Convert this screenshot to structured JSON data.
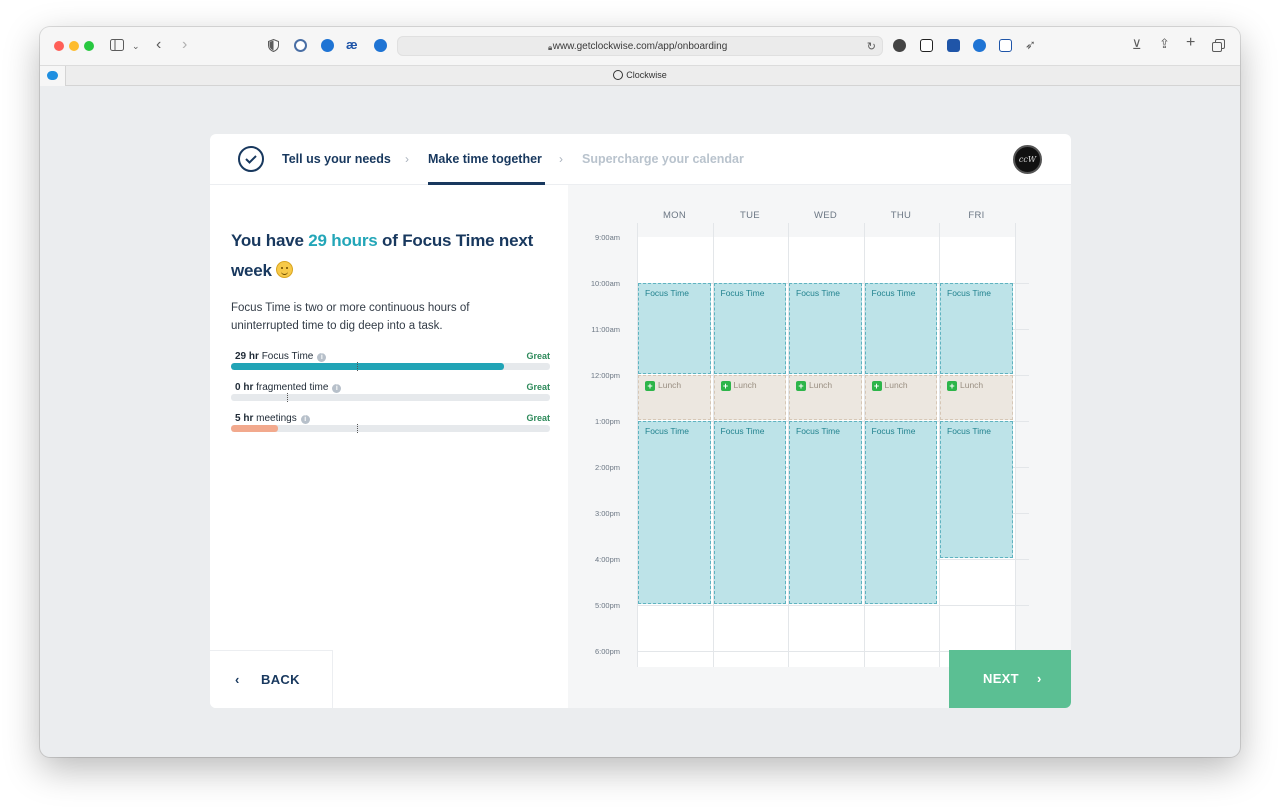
{
  "browser": {
    "url": "www.getclockwise.com/app/onboarding",
    "tab_title": "Clockwise"
  },
  "steps": [
    {
      "label": "Tell us your needs",
      "state": "done"
    },
    {
      "label": "Make time together",
      "state": "active"
    },
    {
      "label": "Supercharge your calendar",
      "state": "upcoming"
    }
  ],
  "avatar_text": "ccW",
  "headline": {
    "prefix": "You have ",
    "accent": "29 hours",
    "suffix": " of Focus Time next week"
  },
  "description": "Focus Time is two or more continuous hours of uninterrupted time to dig deep into a task.",
  "metrics": [
    {
      "value": "29 hr",
      "label": "Focus Time",
      "status": "Great",
      "fill": 0.855,
      "marker": 0.395,
      "color": "#21a4b6"
    },
    {
      "value": "0 hr",
      "label": "fragmented time",
      "status": "Great",
      "fill": 0,
      "marker": 0.175,
      "color": "#21a4b6"
    },
    {
      "value": "5 hr",
      "label": "meetings",
      "status": "Great",
      "fill": 0.148,
      "marker": 0.395,
      "color": "#f2a98d"
    }
  ],
  "calendar": {
    "days": [
      "MON",
      "TUE",
      "WED",
      "THU",
      "FRI"
    ],
    "hours": [
      "9:00am",
      "10:00am",
      "11:00am",
      "12:00pm",
      "1:00pm",
      "2:00pm",
      "3:00pm",
      "4:00pm",
      "5:00pm",
      "6:00pm"
    ],
    "focus_label": "Focus Time",
    "lunch_label": "Lunch",
    "events": [
      {
        "day": 0,
        "type": "focus",
        "start": 10,
        "end": 12
      },
      {
        "day": 1,
        "type": "focus",
        "start": 10,
        "end": 12
      },
      {
        "day": 2,
        "type": "focus",
        "start": 10,
        "end": 12
      },
      {
        "day": 3,
        "type": "focus",
        "start": 10,
        "end": 12
      },
      {
        "day": 4,
        "type": "focus",
        "start": 10,
        "end": 12
      },
      {
        "day": 0,
        "type": "lunch",
        "start": 12,
        "end": 13
      },
      {
        "day": 1,
        "type": "lunch",
        "start": 12,
        "end": 13
      },
      {
        "day": 2,
        "type": "lunch",
        "start": 12,
        "end": 13
      },
      {
        "day": 3,
        "type": "lunch",
        "start": 12,
        "end": 13
      },
      {
        "day": 4,
        "type": "lunch",
        "start": 12,
        "end": 13
      },
      {
        "day": 0,
        "type": "focus",
        "start": 13,
        "end": 17
      },
      {
        "day": 1,
        "type": "focus",
        "start": 13,
        "end": 17
      },
      {
        "day": 2,
        "type": "focus",
        "start": 13,
        "end": 17
      },
      {
        "day": 3,
        "type": "focus",
        "start": 13,
        "end": 17
      },
      {
        "day": 4,
        "type": "focus",
        "start": 13,
        "end": 16
      }
    ]
  },
  "back_label": "BACK",
  "next_label": "NEXT"
}
